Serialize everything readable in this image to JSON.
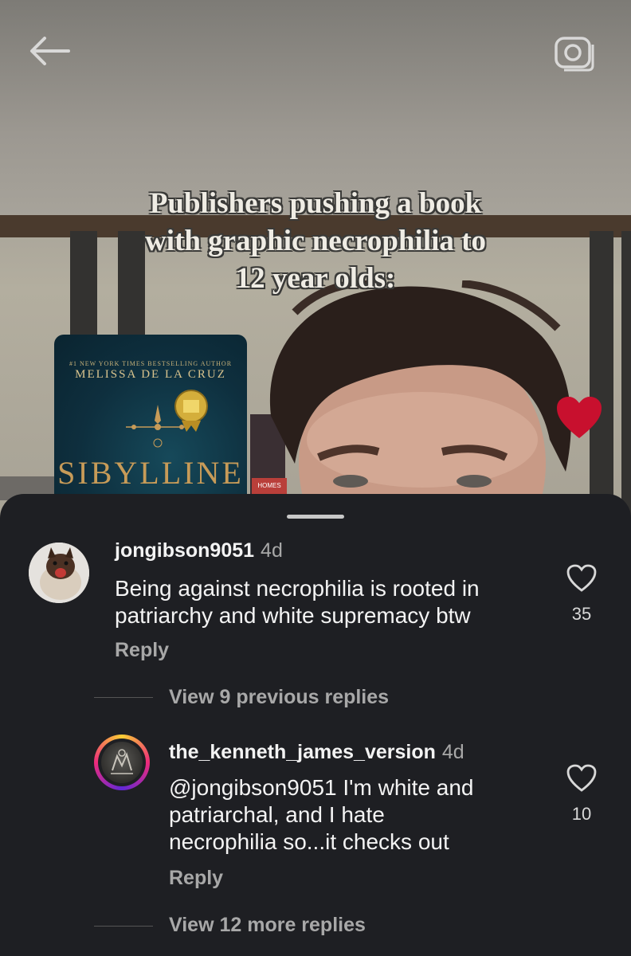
{
  "video": {
    "overlay_lines": [
      "Publishers pushing a book",
      "with graphic necrophilia to",
      "12 year olds:"
    ],
    "book": {
      "tagline": "#1 NEW YORK TIMES BESTSELLING AUTHOR",
      "author": "MELISSA DE LA CRUZ",
      "title": "SIBYLLINE"
    },
    "shelf_book_label": "HOMES"
  },
  "comments": [
    {
      "username": "jongibson9051",
      "time": "4d",
      "lines": [
        "Being against necrophilia is rooted in",
        "patriarchy and white supremacy btw"
      ],
      "likes": "35",
      "reply_label": "Reply"
    },
    {
      "username": "the_kenneth_james_version",
      "time": "4d",
      "lines": [
        "@jongibson9051 I'm white and",
        "patriarchal, and I hate",
        "necrophilia so...it checks out"
      ],
      "likes": "10",
      "reply_label": "Reply"
    }
  ],
  "view_previous": "View 9 previous replies",
  "view_more": "View 12 more replies",
  "colors": {
    "sheet_bg": "#1e1f23",
    "heart_red": "#c8102e",
    "text_primary": "#f3f3f3",
    "text_secondary": "#a8a8a8"
  },
  "icons": [
    "back-arrow-icon",
    "camera-icon",
    "heart-icon",
    "like-heart-icon"
  ]
}
